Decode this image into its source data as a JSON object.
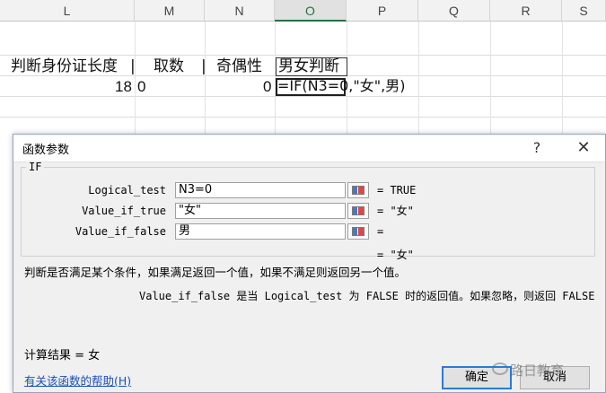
{
  "sheet": {
    "columns": [
      "L",
      "M",
      "N",
      "O",
      "P",
      "Q",
      "R",
      "S"
    ],
    "headers": {
      "id_length": "判断身份证长度",
      "take_digit": "取数",
      "parity": "奇偶性",
      "gender": "男女判断"
    },
    "values": {
      "id_length": "18",
      "take_digit": "0",
      "parity": "0"
    },
    "formula": "=IF(N3=0,\"女\",男)"
  },
  "dialog": {
    "title": "函数参数",
    "help_label": "?",
    "close_label": "✕",
    "function_name": "IF",
    "args": [
      {
        "label": "Logical_test",
        "value": "N3=0",
        "result": "= TRUE"
      },
      {
        "label": "Value_if_true",
        "value": "\"女\"",
        "result": "= \"女\""
      },
      {
        "label": "Value_if_false",
        "value": "男",
        "result": "="
      }
    ],
    "function_result": "= \"女\"",
    "description": "判断是否满足某个条件，如果满足返回一个值，如果不满足则返回另一个值。",
    "arg_description": "Value_if_false   是当 Logical_test 为 FALSE 时的返回值。如果忽略，则返回 FALSE",
    "calc_result": "计算结果 =  女",
    "help_link": "有关该函数的帮助(H)",
    "ok_label": "确定",
    "cancel_label": "取消"
  },
  "watermark": "路日教育",
  "colors": {
    "accent": "#217346",
    "link": "#1a4fb6",
    "ok_border": "#2a7ad6"
  }
}
